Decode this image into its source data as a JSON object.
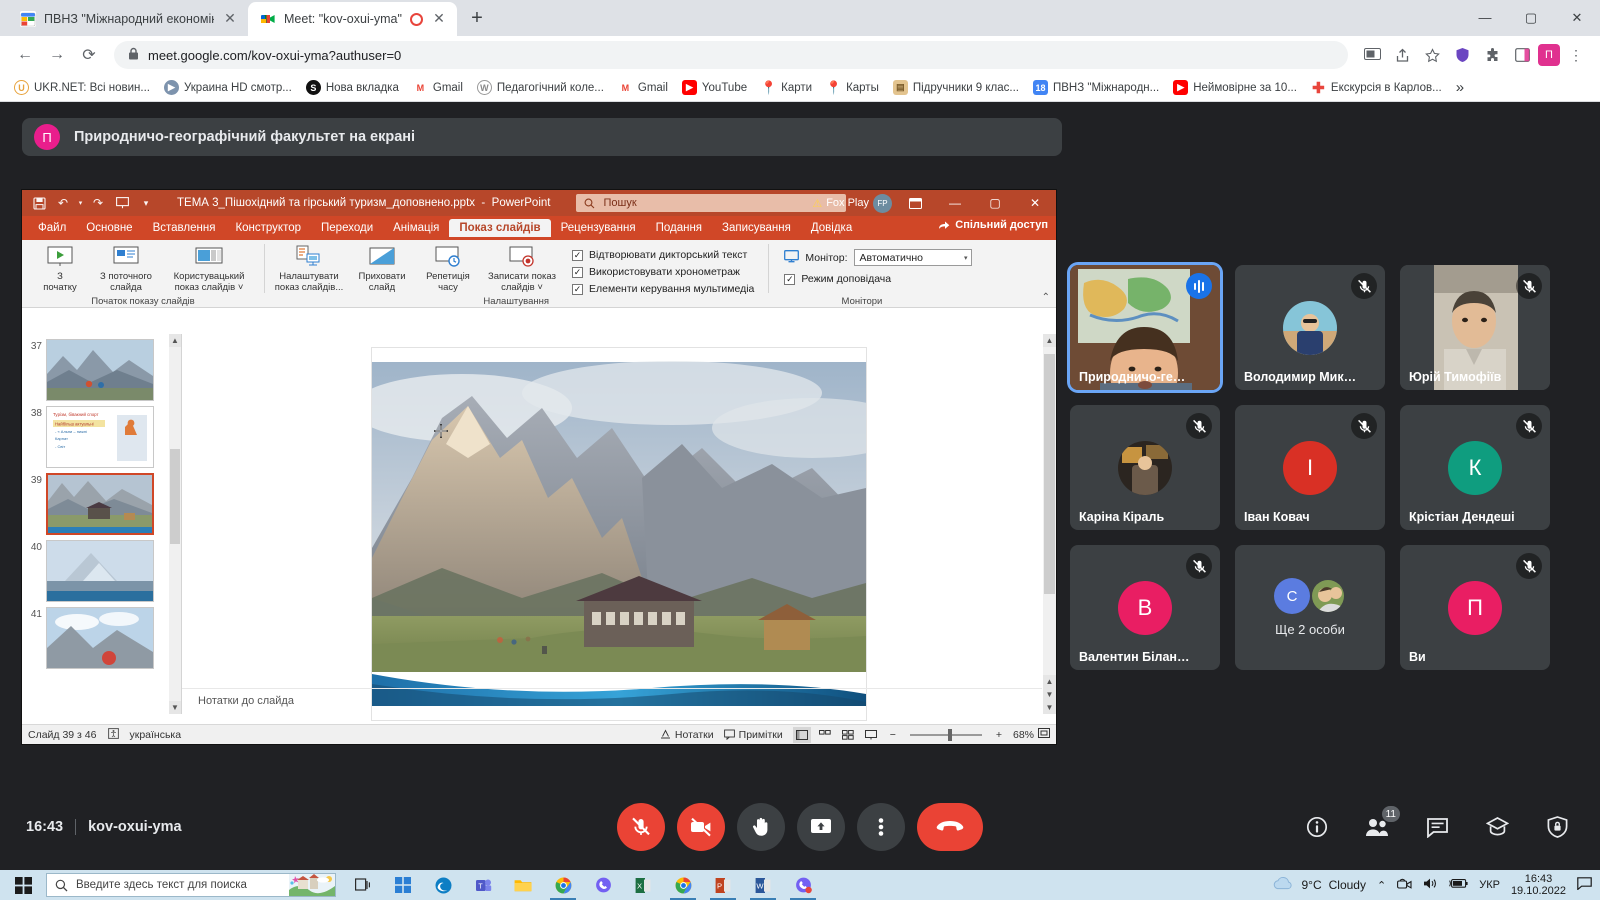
{
  "browser": {
    "tabs": [
      {
        "title": "ПВНЗ \"Міжнародний економіко",
        "favicon_name": "calendar-icon",
        "active": false
      },
      {
        "title": "Meet: \"kov-oxui-yma\"",
        "favicon_name": "google-meet-icon",
        "active": true
      }
    ],
    "new_tab_label": "+",
    "close_label": "✕",
    "back_label": "←",
    "forward_label": "→",
    "reload_label": "⟳",
    "url": "meet.google.com/kov-oxui-yma?authuser=0",
    "url_host": "meet.google.com",
    "url_path": "/kov-oxui-yma?authuser=0",
    "lock_icon": "lock-icon",
    "profile_initial": "П",
    "window_minimize": "—",
    "window_maximize": "▢",
    "window_close": "✕",
    "bookmarks": [
      {
        "label": "UKR.NET: Всі новин...",
        "icon": "ukrnet-icon",
        "color": "#f0a500",
        "letter": "U"
      },
      {
        "label": "Украина HD смотр...",
        "icon": "tv-icon",
        "color": "#6b7fa3",
        "letter": "▶"
      },
      {
        "label": "Нова вкладка",
        "icon": "globe-icon",
        "color": "#111111",
        "letter": "S"
      },
      {
        "label": "Gmail",
        "icon": "gmail-icon",
        "color": "#ffffff",
        "letter": "M"
      },
      {
        "label": "Педагогічний коле...",
        "icon": "wordpress-icon",
        "color": "#cccccc",
        "letter": "W"
      },
      {
        "label": "Gmail",
        "icon": "gmail-icon",
        "color": "#ffffff",
        "letter": "M"
      },
      {
        "label": "YouTube",
        "icon": "youtube-icon",
        "color": "#ff0000",
        "letter": "▶"
      },
      {
        "label": "Карти",
        "icon": "maps-pin-icon",
        "color": "#34a853",
        "letter": "◆"
      },
      {
        "label": "Карты",
        "icon": "maps-pin-icon",
        "color": "#34a853",
        "letter": "◆"
      },
      {
        "label": "Підручники 9 клас...",
        "icon": "book-icon",
        "color": "#e0c08a",
        "letter": "📖"
      },
      {
        "label": "ПВНЗ \"Міжнародн...",
        "icon": "calendar-icon",
        "color": "#4285f4",
        "letter": "18"
      },
      {
        "label": "Неймовірне за 10...",
        "icon": "youtube-icon",
        "color": "#ff0000",
        "letter": "▶"
      },
      {
        "label": "Екскурсія в Карлов...",
        "icon": "plus-red-icon",
        "color": "#ffffff",
        "letter": "✚"
      }
    ],
    "bookmarks_overflow": "»"
  },
  "meet": {
    "header_title": "Природничо-географічний факультет на екрані",
    "header_avatar_letter": "П",
    "clock": "16:43",
    "meeting_code": "kov-oxui-yma",
    "controls": [
      {
        "name": "microphone-off-button",
        "icon": "mic-off-icon",
        "style": "red"
      },
      {
        "name": "camera-off-button",
        "icon": "camera-off-icon",
        "style": "red"
      },
      {
        "name": "raise-hand-button",
        "icon": "hand-icon",
        "style": "grey"
      },
      {
        "name": "present-screen-button",
        "icon": "present-icon",
        "style": "grey"
      },
      {
        "name": "more-options-button",
        "icon": "three-dots-icon",
        "style": "grey"
      },
      {
        "name": "leave-call-button",
        "icon": "phone-hangup-icon",
        "style": "hang"
      }
    ],
    "right_controls": [
      {
        "name": "meeting-details-button",
        "icon": "info-icon",
        "badge": ""
      },
      {
        "name": "participants-button",
        "icon": "people-icon",
        "badge": "11"
      },
      {
        "name": "chat-button",
        "icon": "chat-icon",
        "badge": ""
      },
      {
        "name": "activities-button",
        "icon": "activities-icon",
        "badge": ""
      },
      {
        "name": "host-controls-button",
        "icon": "shield-lock-icon",
        "badge": ""
      }
    ],
    "participants": [
      {
        "name": "Природничо-ге…",
        "type": "video",
        "muted": false,
        "speaking": true,
        "is_me": true
      },
      {
        "name": "Володимир Мик…",
        "type": "photo",
        "muted": true,
        "speaking": false,
        "is_me": false
      },
      {
        "name": "Юрій Тимофіїв",
        "type": "video",
        "muted": true,
        "speaking": false,
        "is_me": false
      },
      {
        "name": "Каріна Кіраль",
        "type": "photo",
        "muted": true,
        "speaking": false,
        "is_me": false
      },
      {
        "name": "Іван Ковач",
        "type": "initial",
        "initial": "І",
        "color": "#d93025",
        "muted": true,
        "speaking": false,
        "is_me": false
      },
      {
        "name": "Крістіан Дендеші",
        "type": "initial",
        "initial": "К",
        "color": "#0f9d7f",
        "muted": true,
        "speaking": false,
        "is_me": false
      },
      {
        "name": "Валентин Білан…",
        "type": "initial",
        "initial": "В",
        "color": "#e91e63",
        "muted": true,
        "speaking": false,
        "is_me": false
      },
      {
        "name": "Ще 2 особи",
        "type": "more",
        "initial": "С",
        "color": "#5b7ce0",
        "muted": false,
        "speaking": false,
        "is_me": false
      },
      {
        "name": "Ви",
        "type": "initial",
        "initial": "П",
        "color": "#e91e63",
        "muted": true,
        "speaking": false,
        "is_me": false
      }
    ]
  },
  "powerpoint": {
    "file_name": "ТЕМА 3_Пішохідний та гірський туризм_доповнено.pptx",
    "app_name": "PowerPoint",
    "title_separator": "-",
    "search_placeholder": "Пошук",
    "quick_access": [
      "save-icon",
      "undo-icon",
      "redo-icon",
      "start-slideshow-icon",
      "customize-qat-icon"
    ],
    "account_name": "Fox Play",
    "account_initials": "FP",
    "warning_icon": "warning-icon",
    "ribbon_display_icon": "ribbon-options-icon",
    "window_minimize": "—",
    "window_restore": "▢",
    "window_close": "✕",
    "share_label": "Спільний доступ",
    "tabs": [
      {
        "label": "Файл",
        "active": false
      },
      {
        "label": "Основне",
        "active": false
      },
      {
        "label": "Вставлення",
        "active": false
      },
      {
        "label": "Конструктор",
        "active": false
      },
      {
        "label": "Переходи",
        "active": false
      },
      {
        "label": "Анімація",
        "active": false
      },
      {
        "label": "Показ слайдів",
        "active": true
      },
      {
        "label": "Рецензування",
        "active": false
      },
      {
        "label": "Подання",
        "active": false
      },
      {
        "label": "Записування",
        "active": false
      },
      {
        "label": "Довідка",
        "active": false
      }
    ],
    "groups": [
      {
        "label": "Початок показу слайдів",
        "items": [
          {
            "caption": "З\nпочатку",
            "line1": "З",
            "line2": "початку",
            "icon": "play-from-start-icon"
          },
          {
            "caption": "З поточного слайда",
            "line1": "З поточного",
            "line2": "слайда",
            "icon": "play-from-current-icon"
          },
          {
            "caption": "Користувацький показ слайдів",
            "line1": "Користувацький",
            "line2": "показ слайдів ˅",
            "icon": "custom-slideshow-icon"
          }
        ]
      },
      {
        "label": "Налаштування",
        "items": [
          {
            "line1": "Налаштувати",
            "line2": "показ слайдів...",
            "icon": "setup-slideshow-icon"
          },
          {
            "line1": "Приховати",
            "line2": "слайд",
            "icon": "hide-slide-icon"
          },
          {
            "line1": "Репетиція",
            "line2": "часу",
            "icon": "rehearse-timings-icon"
          },
          {
            "line1": "Записати показ",
            "line2": "слайдів ˅",
            "icon": "record-slideshow-icon"
          }
        ],
        "checkboxes": [
          {
            "label": "Відтворювати дикторський текст",
            "checked": true
          },
          {
            "label": "Використовувати хронометраж",
            "checked": true
          },
          {
            "label": "Елементи керування мультимедіа",
            "checked": true
          }
        ]
      },
      {
        "label": "Монітори",
        "monitor_label": "Монітор:",
        "monitor_value": "Автоматично",
        "presenter_view_label": "Режим доповідача",
        "presenter_view_checked": true
      }
    ],
    "thumbnails": [
      {
        "num": "37",
        "kind": "mountain-hikers"
      },
      {
        "num": "38",
        "kind": "text-slide"
      },
      {
        "num": "39",
        "kind": "mountain-hut",
        "selected": true
      },
      {
        "num": "40",
        "kind": "mountain-blue"
      },
      {
        "num": "41",
        "kind": "mountain-clouds"
      }
    ],
    "notes_placeholder": "Нотатки до слайда",
    "status": {
      "slide_info": "Слайд 39 з 46",
      "language": "українська",
      "accessibility_icon": "accessibility-icon",
      "notes_label": "Нотатки",
      "comments_label": "Примітки",
      "zoom_value": "68%",
      "zoom_minus": "−",
      "zoom_plus": "+",
      "fit_icon": "fit-slide-icon",
      "views": [
        "normal-view-icon",
        "slide-sorter-icon",
        "reading-view-icon",
        "slideshow-view-icon"
      ]
    },
    "collapse_ribbon_icon": "chevron-up-icon"
  },
  "taskbar": {
    "start_icon": "windows-start-icon",
    "search_placeholder": "Введите здесь текст для поиска",
    "search_icon": "search-icon",
    "apps": [
      {
        "name": "task-view-icon",
        "color": "#2b5797",
        "letter": "❏"
      },
      {
        "name": "microsoft-store-icon",
        "color": "#0078d7",
        "letter": "▣"
      },
      {
        "name": "edge-icon",
        "color": "#0d7ec4",
        "letter": "e"
      },
      {
        "name": "teams-icon",
        "color": "#5059c9",
        "letter": "T"
      },
      {
        "name": "file-explorer-icon",
        "color": "#ffb900",
        "letter": "📁"
      },
      {
        "name": "chrome-icon",
        "color": "#4285f4",
        "letter": "C",
        "active": true
      },
      {
        "name": "viber-icon",
        "color": "#7360f2",
        "letter": "V"
      },
      {
        "name": "excel-icon",
        "color": "#1d6f42",
        "letter": "X"
      },
      {
        "name": "chrome-icon-2",
        "color": "#4285f4",
        "letter": "C",
        "active": true
      },
      {
        "name": "powerpoint-icon",
        "color": "#d04727",
        "letter": "P",
        "active": true
      },
      {
        "name": "word-icon",
        "color": "#2b579a",
        "letter": "W",
        "active": true
      },
      {
        "name": "viber-icon-2",
        "color": "#7360f2",
        "letter": "V",
        "active": true
      }
    ],
    "weather_temp": "9°C",
    "weather_desc": "Cloudy",
    "weather_icon": "cloud-icon",
    "tray_icons": [
      "show-hidden-icons-chevron",
      "camera-icon",
      "volume-icon",
      "battery-icon"
    ],
    "language": "УКР",
    "time": "16:43",
    "date": "19.10.2022",
    "notifications_icon": "notification-icon"
  }
}
